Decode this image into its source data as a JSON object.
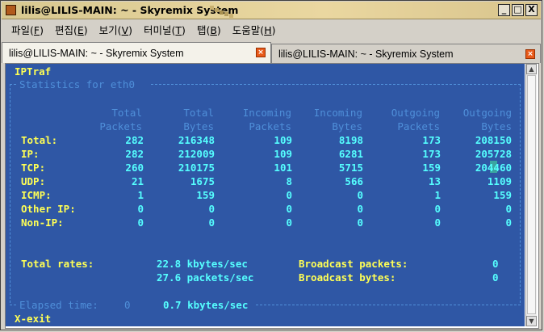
{
  "window": {
    "title": "lilis@LILIS-MAIN: ~ - Skyremix System",
    "buttons": [
      "_",
      "□",
      "X"
    ]
  },
  "menu": [
    {
      "label": "파일(",
      "key": "F",
      "end": ")"
    },
    {
      "label": "편집(",
      "key": "E",
      "end": ")"
    },
    {
      "label": "보기(",
      "key": "V",
      "end": ")"
    },
    {
      "label": "터미널(",
      "key": "T",
      "end": ")"
    },
    {
      "label": "탭(",
      "key": "B",
      "end": ")"
    },
    {
      "label": "도움말(",
      "key": "H",
      "end": ")"
    }
  ],
  "tabs": [
    {
      "label": "lilis@LILIS-MAIN: ~ - Skyremix System",
      "active": true
    },
    {
      "label": "lilis@LILIS-MAIN: ~ - Skyremix System",
      "active": false
    }
  ],
  "terminal": {
    "app_name": "IPTraf",
    "panel_title": "Statistics for eth0",
    "column_headers": [
      [
        "Total",
        "Packets"
      ],
      [
        "Total",
        "Bytes"
      ],
      [
        "Incoming",
        "Packets"
      ],
      [
        "Incoming",
        "Bytes"
      ],
      [
        "Outgoing",
        "Packets"
      ],
      [
        "Outgoing",
        "Bytes"
      ]
    ],
    "rows": [
      {
        "label": "Total:",
        "values": [
          "282",
          "216348",
          "109",
          "8198",
          "173",
          "208150"
        ]
      },
      {
        "label": "IP:",
        "values": [
          "282",
          "212009",
          "109",
          "6281",
          "173",
          "205728"
        ]
      },
      {
        "label": "TCP:",
        "values": [
          "260",
          "210175",
          "101",
          "5715",
          "159",
          "204460"
        ]
      },
      {
        "label": "UDP:",
        "values": [
          "21",
          "1675",
          "8",
          "566",
          "13",
          "1109"
        ]
      },
      {
        "label": "ICMP:",
        "values": [
          "1",
          "159",
          "0",
          "0",
          "1",
          "159"
        ]
      },
      {
        "label": "Other IP:",
        "values": [
          "0",
          "0",
          "0",
          "0",
          "0",
          "0"
        ]
      },
      {
        "label": "Non-IP:",
        "values": [
          "0",
          "0",
          "0",
          "0",
          "0",
          "0"
        ]
      }
    ],
    "rates": {
      "label": "Total rates:",
      "kbytes": "22.8 kbytes/sec",
      "packets": "27.6 packets/sec",
      "broadcast_packets_label": "Broadcast packets:",
      "broadcast_packets_value": "0",
      "broadcast_bytes_label": "Broadcast bytes:",
      "broadcast_bytes_value": "0"
    },
    "elapsed": {
      "label": "Elapsed time:",
      "value": "0",
      "rate": "0.7 kbytes/sec"
    },
    "footer": "X-exit"
  },
  "colors": {
    "terminal_bg": "#2f57a5",
    "label_yellow": "#ffff55",
    "value_cyan": "#55ffff",
    "dim_blue": "#4f8fd9"
  }
}
